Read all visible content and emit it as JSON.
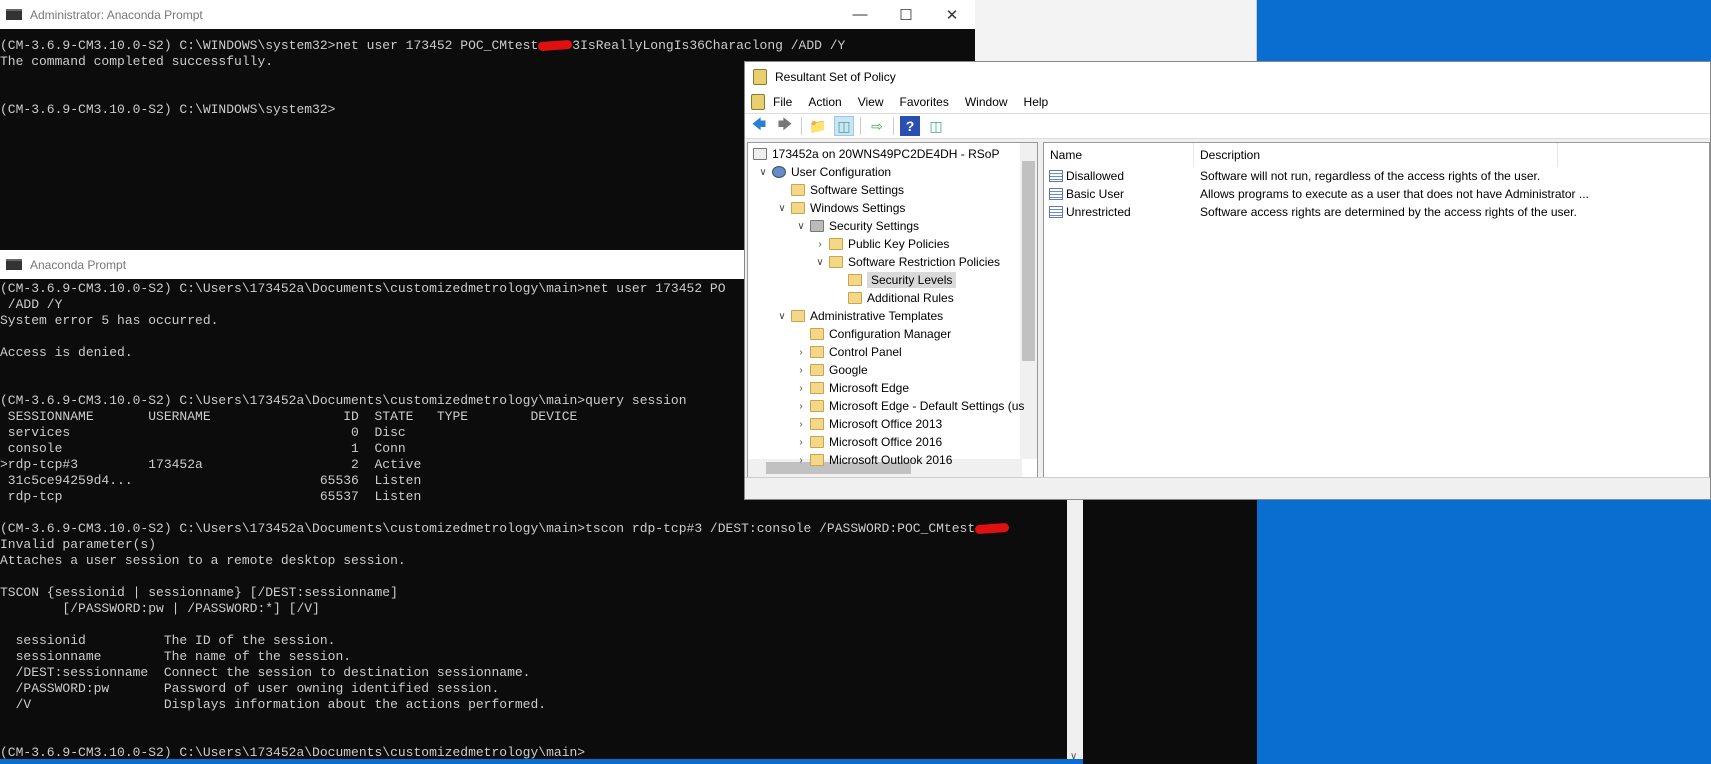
{
  "admin_prompt": {
    "title": "Administrator: Anaconda Prompt",
    "lines": [
      {
        "before": "(CM-3.6.9-CM3.10.0-S2) C:\\WINDOWS\\system32>net user 173452 POC_CMtest",
        "after": "3IsReallyLongIs36Characlong /ADD /Y",
        "redacted": true
      },
      {
        "before": "The command completed successfully."
      },
      {
        "before": ""
      },
      {
        "before": ""
      },
      {
        "before": "(CM-3.6.9-CM3.10.0-S2) C:\\WINDOWS\\system32>"
      }
    ]
  },
  "prompt": {
    "title": "Anaconda Prompt",
    "lines": [
      {
        "before": "(CM-3.6.9-CM3.10.0-S2) C:\\Users\\173452a\\Documents\\customizedmetrology\\main>net user 173452 PO"
      },
      {
        "before": " /ADD /Y"
      },
      {
        "before": "System error 5 has occurred."
      },
      {
        "before": ""
      },
      {
        "before": "Access is denied."
      },
      {
        "before": ""
      },
      {
        "before": ""
      },
      {
        "before": "(CM-3.6.9-CM3.10.0-S2) C:\\Users\\173452a\\Documents\\customizedmetrology\\main>query session"
      },
      {
        "before": " SESSIONNAME       USERNAME                 ID  STATE   TYPE        DEVICE"
      },
      {
        "before": " services                                    0  Disc"
      },
      {
        "before": " console                                     1  Conn"
      },
      {
        "before": ">rdp-tcp#3         173452a                   2  Active"
      },
      {
        "before": " 31c5ce94259d4...                        65536  Listen"
      },
      {
        "before": " rdp-tcp                                 65537  Listen"
      },
      {
        "before": ""
      },
      {
        "before": "(CM-3.6.9-CM3.10.0-S2) C:\\Users\\173452a\\Documents\\customizedmetrology\\main>tscon rdp-tcp#3 /DEST:console /PASSWORD:POC_CMtest",
        "after": "",
        "redacted": true
      },
      {
        "before": "Invalid parameter(s)"
      },
      {
        "before": "Attaches a user session to a remote desktop session."
      },
      {
        "before": ""
      },
      {
        "before": "TSCON {sessionid | sessionname} [/DEST:sessionname]"
      },
      {
        "before": "        [/PASSWORD:pw | /PASSWORD:*] [/V]"
      },
      {
        "before": ""
      },
      {
        "before": "  sessionid          The ID of the session."
      },
      {
        "before": "  sessionname        The name of the session."
      },
      {
        "before": "  /DEST:sessionname  Connect the session to destination sessionname."
      },
      {
        "before": "  /PASSWORD:pw       Password of user owning identified session."
      },
      {
        "before": "  /V                 Displays information about the actions performed."
      },
      {
        "before": ""
      },
      {
        "before": ""
      },
      {
        "before": "(CM-3.6.9-CM3.10.0-S2) C:\\Users\\173452a\\Documents\\customizedmetrology\\main>"
      }
    ]
  },
  "rsop": {
    "title": "Resultant Set of Policy",
    "menu": [
      "File",
      "Action",
      "View",
      "Favorites",
      "Window",
      "Help"
    ],
    "tree": [
      {
        "label": "173452a on 20WNS49PC2DE4DH - RSoP",
        "level": 0,
        "exp": "",
        "icon": "rsop"
      },
      {
        "label": "User Configuration",
        "level": 1,
        "exp": "v",
        "icon": "user"
      },
      {
        "label": "Software Settings",
        "level": 2,
        "exp": "",
        "icon": "folder"
      },
      {
        "label": "Windows Settings",
        "level": 2,
        "exp": "v",
        "icon": "folder"
      },
      {
        "label": "Security Settings",
        "level": 3,
        "exp": "v",
        "icon": "security"
      },
      {
        "label": "Public Key Policies",
        "level": 4,
        "exp": ">",
        "icon": "folder"
      },
      {
        "label": "Software Restriction Policies",
        "level": 4,
        "exp": "v",
        "icon": "folder"
      },
      {
        "label": "Security Levels",
        "level": 5,
        "exp": "",
        "icon": "folder",
        "selected": true
      },
      {
        "label": "Additional Rules",
        "level": 5,
        "exp": "",
        "icon": "folder"
      },
      {
        "label": "Administrative Templates",
        "level": 2,
        "exp": "v",
        "icon": "folder"
      },
      {
        "label": "Configuration Manager",
        "level": 3,
        "exp": "",
        "icon": "folder"
      },
      {
        "label": "Control Panel",
        "level": 3,
        "exp": ">",
        "icon": "folder"
      },
      {
        "label": "Google",
        "level": 3,
        "exp": ">",
        "icon": "folder"
      },
      {
        "label": "Microsoft Edge",
        "level": 3,
        "exp": ">",
        "icon": "folder"
      },
      {
        "label": "Microsoft Edge - Default Settings (us",
        "level": 3,
        "exp": ">",
        "icon": "folder"
      },
      {
        "label": "Microsoft Office 2013",
        "level": 3,
        "exp": ">",
        "icon": "folder"
      },
      {
        "label": "Microsoft Office 2016",
        "level": 3,
        "exp": ">",
        "icon": "folder"
      },
      {
        "label": "Microsoft Outlook 2016",
        "level": 3,
        "exp": ">",
        "icon": "folder"
      }
    ],
    "columns": {
      "name": "Name",
      "description": "Description"
    },
    "rows": [
      {
        "name": "Disallowed",
        "description": "Software will not run, regardless of the access rights of the user."
      },
      {
        "name": "Basic User",
        "description": "Allows programs to execute as a user that does not have Administrator ..."
      },
      {
        "name": "Unrestricted",
        "description": "Software access rights are determined by the access rights of the user."
      }
    ]
  },
  "colors": {
    "desktop": "#0a6ed1",
    "console_bg": "#0c0c0c",
    "redaction": "#e01010"
  }
}
